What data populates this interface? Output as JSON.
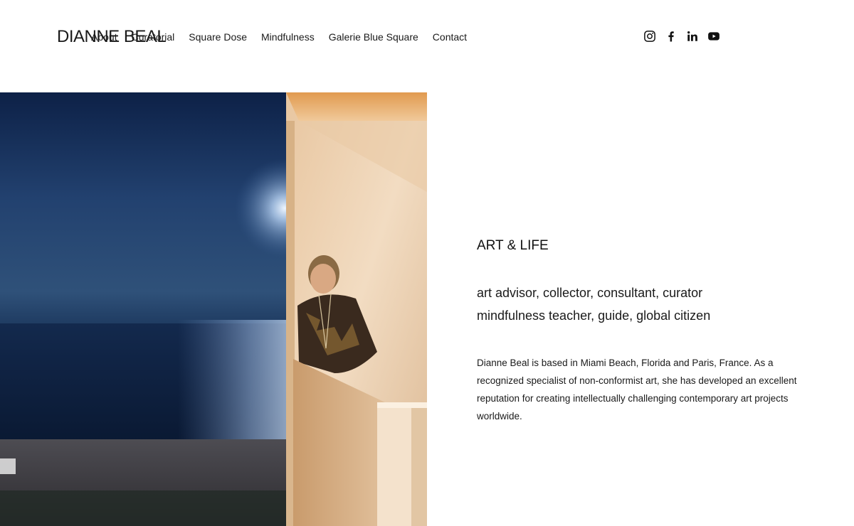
{
  "header": {
    "site_title": "DIANNE BEAL",
    "nav": [
      {
        "label": "About"
      },
      {
        "label": "Curatorial"
      },
      {
        "label": "Square Dose"
      },
      {
        "label": "Mindfulness"
      },
      {
        "label": "Galerie Blue Square"
      },
      {
        "label": "Contact"
      }
    ],
    "social": [
      {
        "icon": "instagram-icon"
      },
      {
        "icon": "facebook-icon"
      },
      {
        "icon": "linkedin-icon"
      },
      {
        "icon": "youtube-icon"
      }
    ]
  },
  "main": {
    "heading": "ART & LIFE",
    "roles": [
      "art advisor, collector, consultant, curator",
      "mindfulness teacher, guide, global citizen"
    ],
    "bio": "Dianne Beal is based in Miami Beach, Florida and Paris, France.  As a recognized specialist of non-conformist art, she has developed an excellent reputation for creating intellectually challenging contemporary art projects worldwide."
  },
  "colors": {
    "text": "#1a1a1a",
    "background": "#ffffff"
  }
}
